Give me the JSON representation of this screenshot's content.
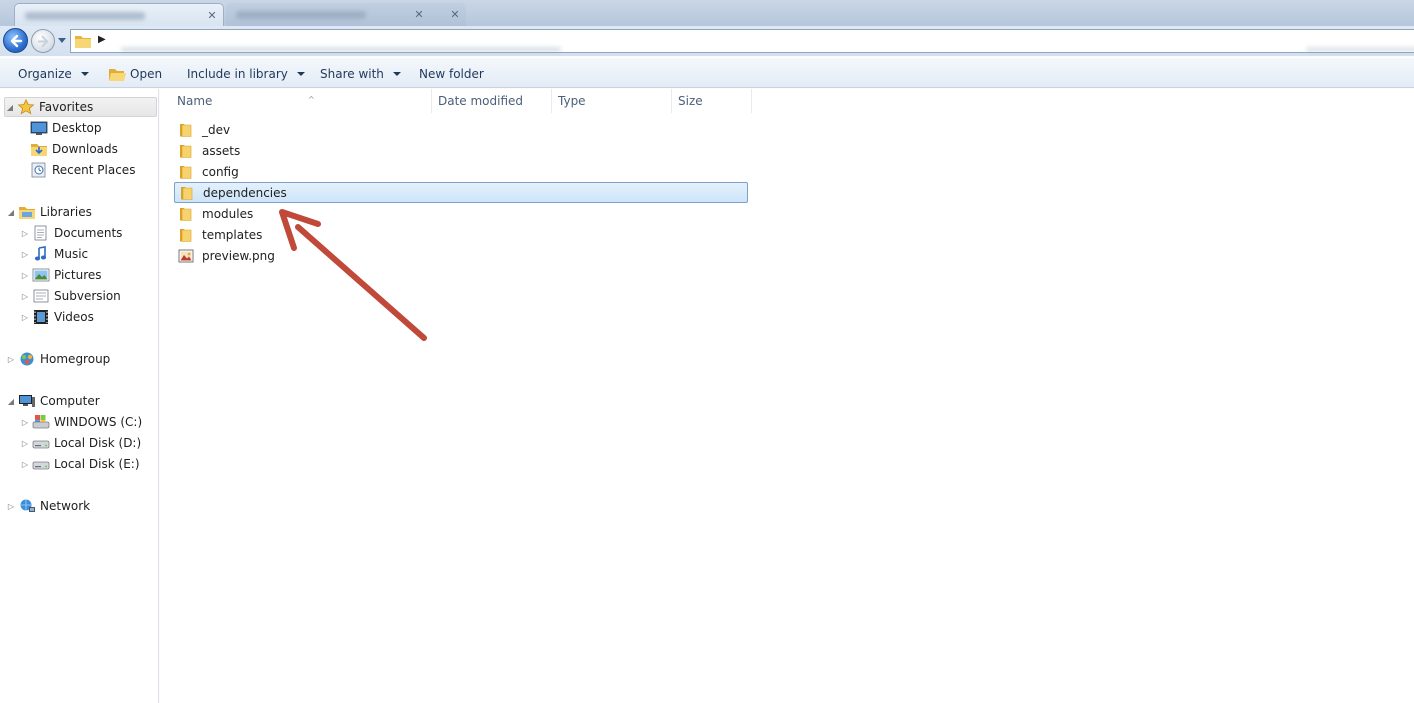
{
  "window": {
    "tabs": [
      {
        "label": "",
        "active": true
      },
      {
        "label": "",
        "active": false
      }
    ]
  },
  "address_bar": {
    "path_segments": []
  },
  "toolbar": {
    "organize": "Organize",
    "open": "Open",
    "include_in_library": "Include in library",
    "share_with": "Share with",
    "new_folder": "New folder"
  },
  "nav_pane": {
    "favorites": {
      "label": "Favorites",
      "items": [
        {
          "label": "Desktop",
          "icon": "desktop-icon"
        },
        {
          "label": "Downloads",
          "icon": "downloads-icon"
        },
        {
          "label": "Recent Places",
          "icon": "recent-places-icon"
        }
      ]
    },
    "libraries": {
      "label": "Libraries",
      "items": [
        {
          "label": "Documents",
          "icon": "documents-icon"
        },
        {
          "label": "Music",
          "icon": "music-icon"
        },
        {
          "label": "Pictures",
          "icon": "pictures-icon"
        },
        {
          "label": "Subversion",
          "icon": "subversion-icon"
        },
        {
          "label": "Videos",
          "icon": "videos-icon"
        }
      ]
    },
    "homegroup": {
      "label": "Homegroup"
    },
    "computer": {
      "label": "Computer",
      "items": [
        {
          "label": "WINDOWS (C:)",
          "icon": "system-drive-icon"
        },
        {
          "label": "Local Disk (D:)",
          "icon": "disk-drive-icon"
        },
        {
          "label": "Local Disk (E:)",
          "icon": "disk-drive-icon"
        }
      ]
    },
    "network": {
      "label": "Network"
    }
  },
  "content": {
    "columns": [
      "Name",
      "Date modified",
      "Type",
      "Size"
    ],
    "files": [
      {
        "name": "_dev",
        "kind": "folder",
        "selected": false
      },
      {
        "name": "assets",
        "kind": "folder",
        "selected": false
      },
      {
        "name": "config",
        "kind": "folder",
        "selected": false
      },
      {
        "name": "dependencies",
        "kind": "folder",
        "selected": true
      },
      {
        "name": "modules",
        "kind": "folder",
        "selected": false
      },
      {
        "name": "templates",
        "kind": "folder",
        "selected": false
      },
      {
        "name": "preview.png",
        "kind": "image",
        "selected": false
      }
    ]
  },
  "colors": {
    "selection_fill": "#cde4f9",
    "selection_border": "#7da2ce",
    "annotation_arrow": "#c0493a",
    "folder_yellow": "#f2c94c"
  }
}
